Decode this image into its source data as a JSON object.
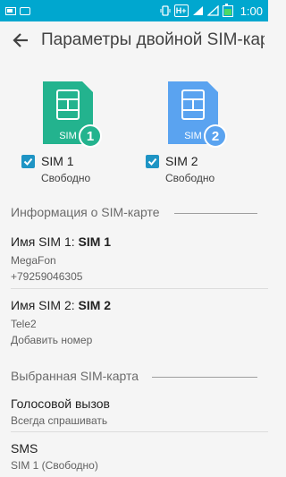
{
  "status_bar": {
    "time": "1:00",
    "network_label": "H+",
    "icons": [
      "mail-icon",
      "gallery-icon",
      "vibrate-icon",
      "sim-signal-icon",
      "signal-icon",
      "battery-icon"
    ],
    "color": "#00a7cf"
  },
  "app_bar": {
    "title": "Параметры двойной SIM-карты",
    "back_icon": "arrow-back-icon"
  },
  "sims": [
    {
      "label": "SIM 1",
      "status": "Свободно",
      "number": "1",
      "color": "#23b38e",
      "checked": true
    },
    {
      "label": "SIM 2",
      "status": "Свободно",
      "number": "2",
      "color": "#5aa3f0",
      "checked": true
    }
  ],
  "sim_card_label": "SIM",
  "info_section": {
    "header": "Информация о SIM-карте",
    "items": [
      {
        "prefix": "Имя SIM 1: ",
        "name": "SIM 1",
        "line1": "MegaFon",
        "line2": "+79259046305"
      },
      {
        "prefix": "Имя SIM 2: ",
        "name": "SIM 2",
        "line1": "Tele2",
        "line2": "Добавить номер"
      }
    ]
  },
  "preferred_section": {
    "header": "Выбранная SIM-карта",
    "items": [
      {
        "title": "Голосовой вызов",
        "sub": "Всегда спрашивать"
      },
      {
        "title": "SMS",
        "sub": "SIM 1 (Свободно)"
      }
    ]
  },
  "accent_color": "#1e94c4"
}
